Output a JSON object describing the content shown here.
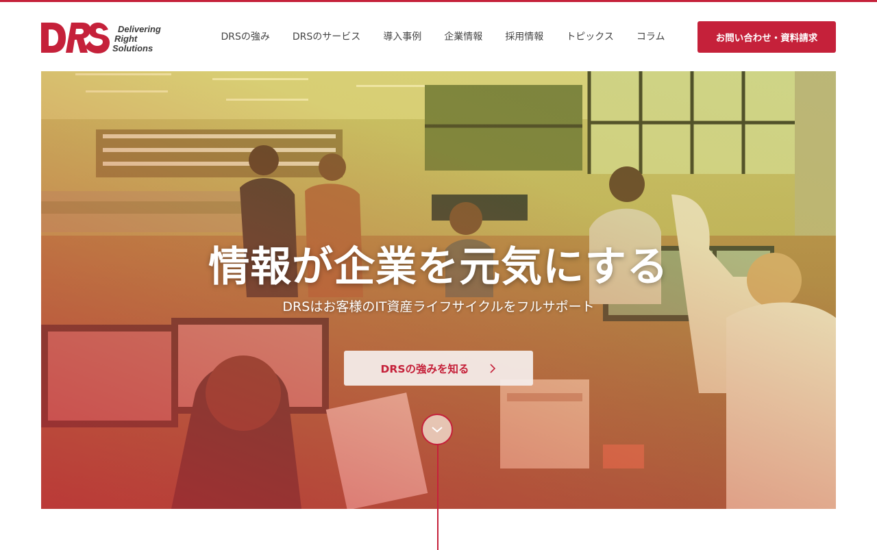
{
  "brand": {
    "logo_text": "DRS",
    "tagline": [
      "Delivering",
      "Right",
      "Solutions"
    ],
    "accent_color": "#c5213a"
  },
  "nav": {
    "items": [
      {
        "label": "DRSの強み"
      },
      {
        "label": "DRSのサービス"
      },
      {
        "label": "導入事例"
      },
      {
        "label": "企業情報"
      },
      {
        "label": "採用情報"
      },
      {
        "label": "トピックス"
      },
      {
        "label": "コラム"
      }
    ],
    "cta_label": "お問い合わせ・資料請求"
  },
  "hero": {
    "title": "情報が企業を元気にする",
    "subtitle": "DRSはお客様のIT資産ライフサイクルをフルサポート",
    "button_label": "DRSの強みを知る",
    "button_icon": "chevron-right-icon",
    "scroll_icon": "chevron-down-icon"
  }
}
